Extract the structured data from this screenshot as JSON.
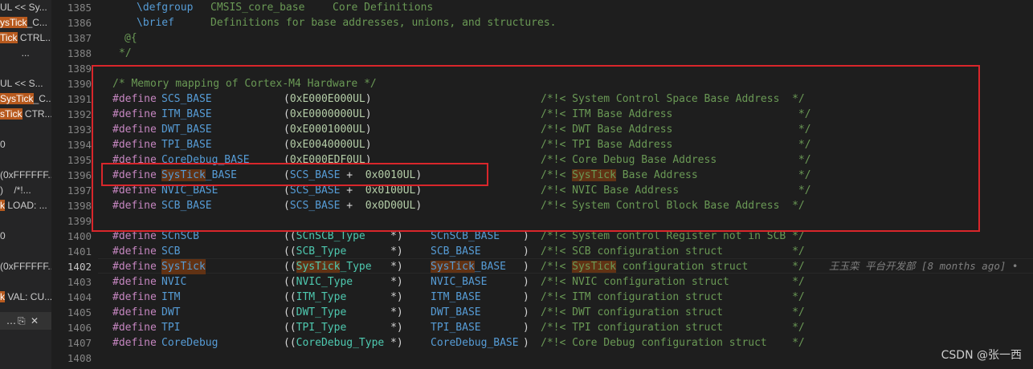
{
  "sidebar": {
    "lines": [
      {
        "text": "UL << Sy...",
        "hl": ""
      },
      {
        "text": "ysTick_C...",
        "hl": "ysTick"
      },
      {
        "text": "Tick CTRL...",
        "hl": "Tick"
      },
      {
        "text": "        ...",
        "hl": ""
      },
      {
        "text": "",
        "hl": ""
      },
      {
        "text": "UL << S...",
        "hl": ""
      },
      {
        "text": "SysTick_C...",
        "hl": "SysTick"
      },
      {
        "text": "sTick CTR...",
        "hl": "sTick"
      },
      {
        "text": "",
        "hl": ""
      },
      {
        "text": "0",
        "hl": ""
      },
      {
        "text": "",
        "hl": ""
      },
      {
        "text": "(0xFFFFFF...",
        "hl": ""
      },
      {
        "text": ")    /*!...",
        "hl": ""
      },
      {
        "text": "k LOAD: ...",
        "hl": "k"
      },
      {
        "text": "",
        "hl": ""
      },
      {
        "text": "0",
        "hl": ""
      },
      {
        "text": "",
        "hl": ""
      },
      {
        "text": "(0xFFFFFF...",
        "hl": ""
      },
      {
        "text": "",
        "hl": ""
      },
      {
        "text": "k VAL: CU...",
        "hl": "k"
      }
    ],
    "toolbar": {
      "dots": "…",
      "copy_icon": "⎘",
      "close_icon": "✕"
    }
  },
  "gutter": {
    "line_numbers": [
      "1385",
      "1386",
      "1387",
      "1388",
      "1389",
      "1390",
      "1391",
      "1392",
      "1393",
      "1394",
      "1395",
      "1396",
      "1397",
      "1398",
      "1399",
      "1400",
      "1401",
      "1402",
      "1403",
      "1404",
      "1405",
      "1406",
      "1407",
      "1408"
    ],
    "active": "1402"
  },
  "code": {
    "l1385": {
      "tag": "\\defgroup",
      "arg": "CMSIS_core_base",
      "desc": "Core Definitions"
    },
    "l1386": {
      "tag": "\\brief",
      "desc": "Definitions for base addresses, unions, and structures."
    },
    "l1387": "@{",
    "l1388": "*/",
    "l1390": "/* Memory mapping of Cortex-M4 Hardware */",
    "base_defines": [
      {
        "kw": "#define",
        "name": "SCS_BASE",
        "value": "(0xE000E000UL)",
        "comment": "/*!< System Control Space Base Address  */"
      },
      {
        "kw": "#define",
        "name": "ITM_BASE",
        "value": "(0xE0000000UL)",
        "comment": "/*!< ITM Base Address                    */"
      },
      {
        "kw": "#define",
        "name": "DWT_BASE",
        "value": "(0xE0001000UL)",
        "comment": "/*!< DWT Base Address                    */"
      },
      {
        "kw": "#define",
        "name": "TPI_BASE",
        "value": "(0xE0040000UL)",
        "comment": "/*!< TPI Base Address                    */"
      },
      {
        "kw": "#define",
        "name": "CoreDebug_BASE",
        "value": "(0xE000EDF0UL)",
        "comment": "/*!< Core Debug Base Address             */"
      },
      {
        "kw": "#define",
        "name": "SysTick_BASE",
        "value": "(SCS_BASE +  0x0010UL)",
        "comment": "/*!< SysTick Base Address                */"
      },
      {
        "kw": "#define",
        "name": "NVIC_BASE",
        "value": "(SCS_BASE +  0x0100UL)",
        "comment": "/*!< NVIC Base Address                   */"
      },
      {
        "kw": "#define",
        "name": "SCB_BASE",
        "value": "(SCS_BASE +  0x0D00UL)",
        "comment": "/*!< System Control Block Base Address  */"
      }
    ],
    "struct_defines": [
      {
        "kw": "#define",
        "name": "SCnSCB",
        "type": "((SCnSCB_Type    *)",
        "base": "SCnSCB_BASE",
        "close": ")",
        "comment": "/*!< System control Register not in SCB */"
      },
      {
        "kw": "#define",
        "name": "SCB",
        "type": "((SCB_Type       *)",
        "base": "SCB_BASE",
        "close": ")",
        "comment": "/*!< SCB configuration struct           */"
      },
      {
        "kw": "#define",
        "name": "SysTick",
        "type": "((SysTick_Type   *)",
        "base": "SysTick_BASE",
        "close": ")",
        "comment": "/*!< SysTick configuration struct       */"
      },
      {
        "kw": "#define",
        "name": "NVIC",
        "type": "((NVIC_Type      *)",
        "base": "NVIC_BASE",
        "close": ")",
        "comment": "/*!< NVIC configuration struct          */"
      },
      {
        "kw": "#define",
        "name": "ITM",
        "type": "((ITM_Type       *)",
        "base": "ITM_BASE",
        "close": ")",
        "comment": "/*!< ITM configuration struct           */"
      },
      {
        "kw": "#define",
        "name": "DWT",
        "type": "((DWT_Type       *)",
        "base": "DWT_BASE",
        "close": ")",
        "comment": "/*!< DWT configuration struct           */"
      },
      {
        "kw": "#define",
        "name": "TPI",
        "type": "((TPI_Type       *)",
        "base": "TPI_BASE",
        "close": ")",
        "comment": "/*!< TPI configuration struct           */"
      },
      {
        "kw": "#define",
        "name": "CoreDebug",
        "type": "((CoreDebug_Type *)",
        "base": "CoreDebug_BASE",
        "close": ")",
        "comment": "/*!< Core Debug configuration struct    */"
      }
    ],
    "blame": "王玉栾 平台开发部 [8 months ago] •"
  },
  "watermark": "CSDN @张一西",
  "colors": {
    "red_box": "#d9262b",
    "highlight": "#613214",
    "editor_bg": "#1e1e1e"
  }
}
